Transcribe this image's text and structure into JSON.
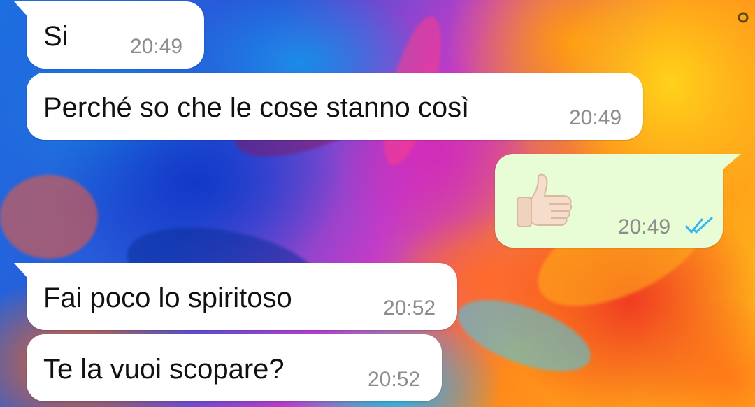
{
  "chat": {
    "messages": [
      {
        "direction": "incoming",
        "text": "Si",
        "time": "20:49"
      },
      {
        "direction": "incoming",
        "text": "Perché so che le cose stanno così",
        "time": "20:49"
      },
      {
        "direction": "outgoing",
        "text": "",
        "emoji": "thumbs-up",
        "time": "20:49",
        "status": "read"
      },
      {
        "direction": "incoming",
        "text": "Fai poco lo spiritoso",
        "time": "20:52"
      },
      {
        "direction": "incoming",
        "text": "Te la vuoi scopare?",
        "time": "20:52"
      }
    ]
  },
  "colors": {
    "incoming_bubble": "#ffffff",
    "outgoing_bubble": "#e8fcd6",
    "timestamp": "#8c8c8c",
    "read_ticks": "#34b7f1"
  },
  "icons": {
    "read_receipt": "double-check-icon",
    "emoji": "thumbs-up-emoji"
  }
}
